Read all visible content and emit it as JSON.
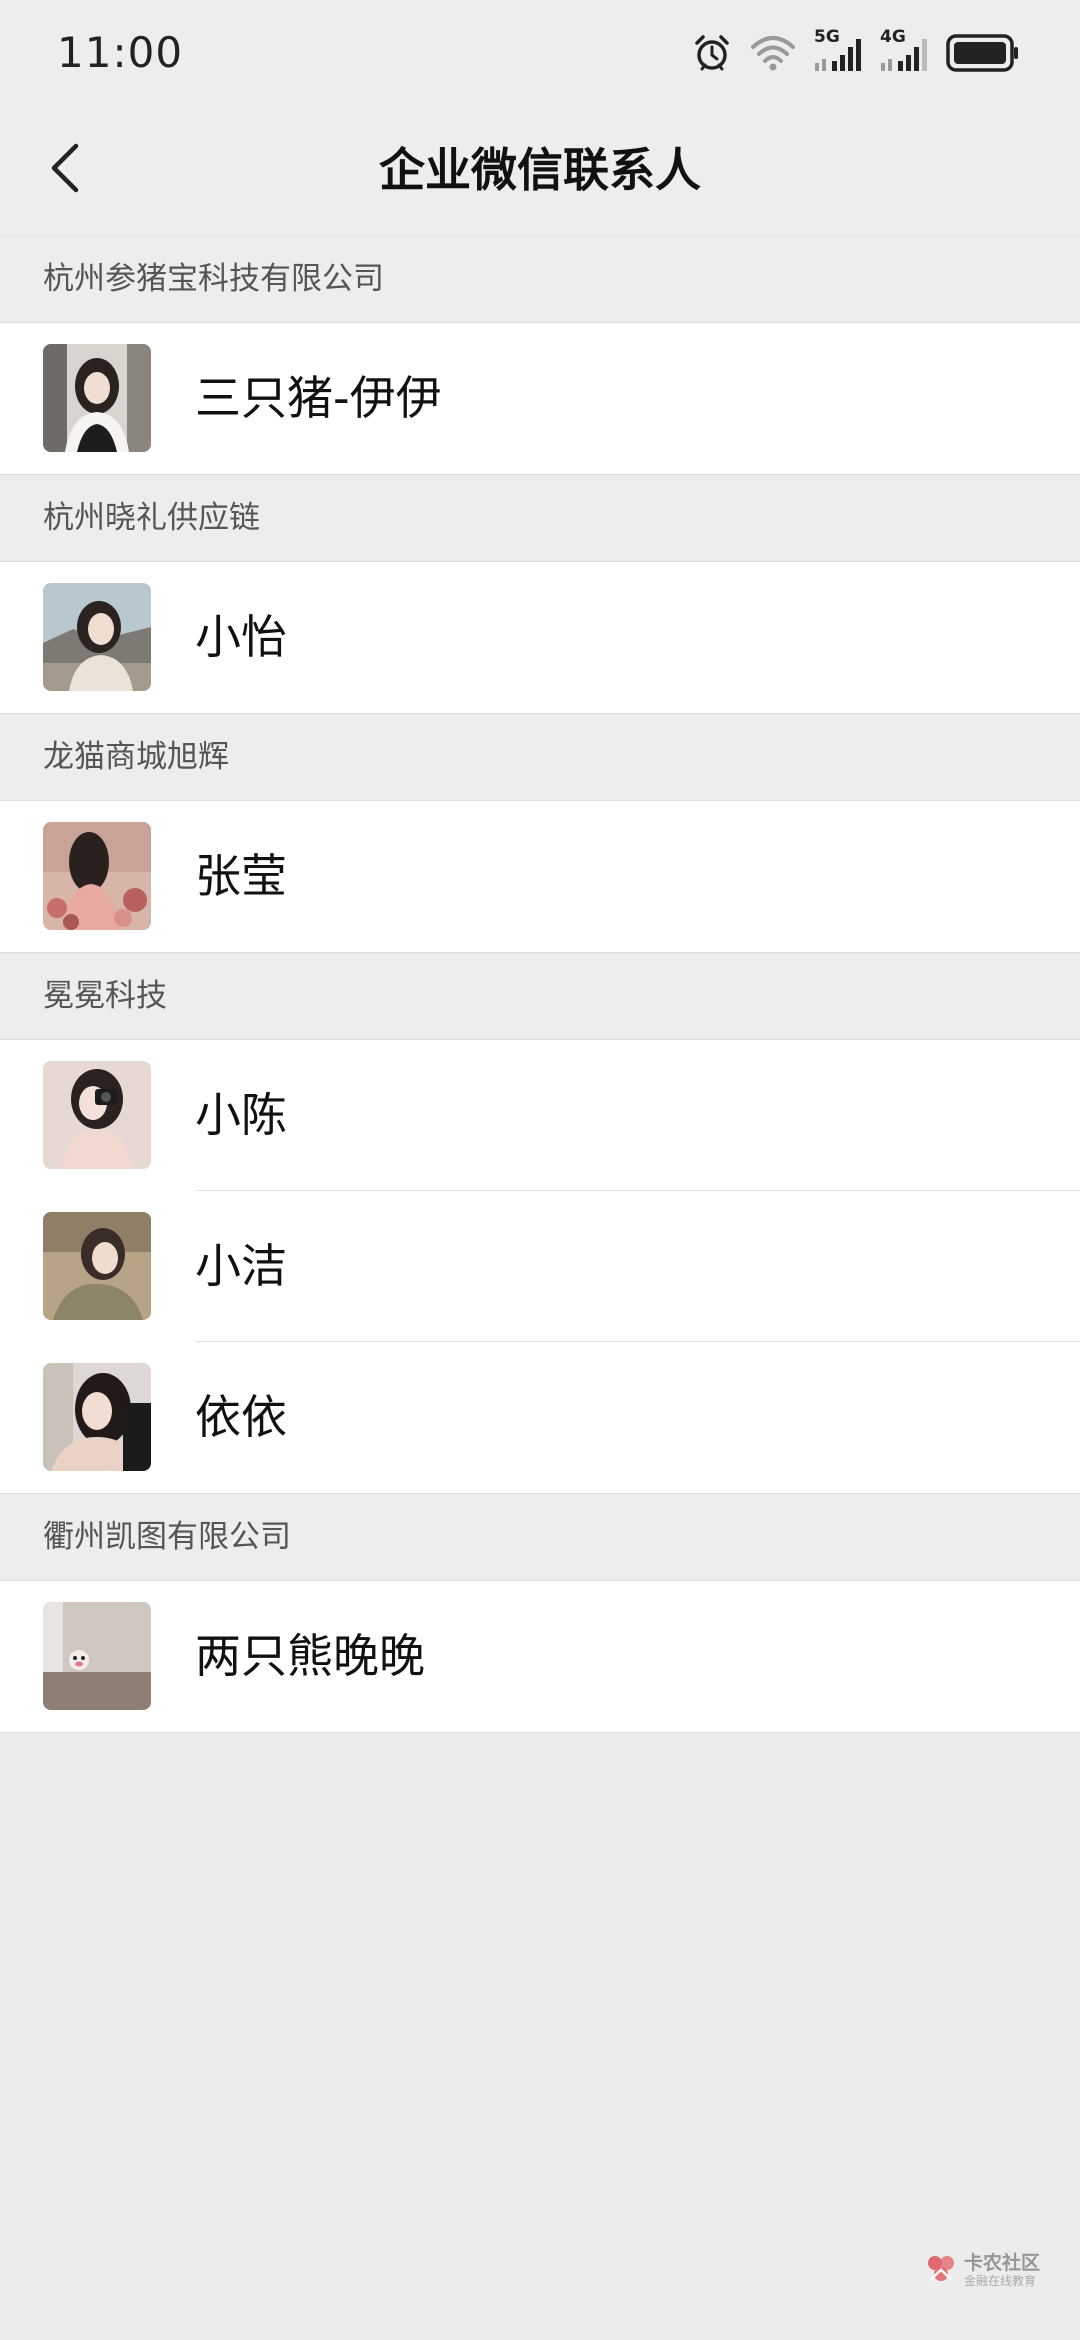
{
  "status_bar": {
    "time": "11:00",
    "icons": [
      "alarm-icon",
      "wifi-icon",
      "signal-5g-icon",
      "signal-4g-icon",
      "battery-icon"
    ],
    "net_5g": "5G",
    "net_4g": "4G"
  },
  "nav": {
    "title": "企业微信联系人",
    "back_icon": "chevron-left-icon"
  },
  "groups": [
    {
      "name": "杭州参猪宝科技有限公司",
      "contacts": [
        {
          "name": "三只猪-伊伊"
        }
      ]
    },
    {
      "name": "杭州晓礼供应链",
      "contacts": [
        {
          "name": "小怡"
        }
      ]
    },
    {
      "name": "龙猫商城旭辉",
      "contacts": [
        {
          "name": "张莹"
        }
      ]
    },
    {
      "name": "冕冕科技",
      "contacts": [
        {
          "name": "小陈"
        },
        {
          "name": "小洁"
        },
        {
          "name": "依依"
        }
      ]
    },
    {
      "name": "衢州凯图有限公司",
      "contacts": [
        {
          "name": "两只熊晚晚"
        }
      ]
    }
  ],
  "watermark": {
    "title": "卡农社区",
    "subtitle": "金融在线教育"
  },
  "colors": {
    "background": "#ececec",
    "row": "#ffffff",
    "header_text": "#555555",
    "name_text": "#111111",
    "watermark_red": "#e0525a"
  }
}
